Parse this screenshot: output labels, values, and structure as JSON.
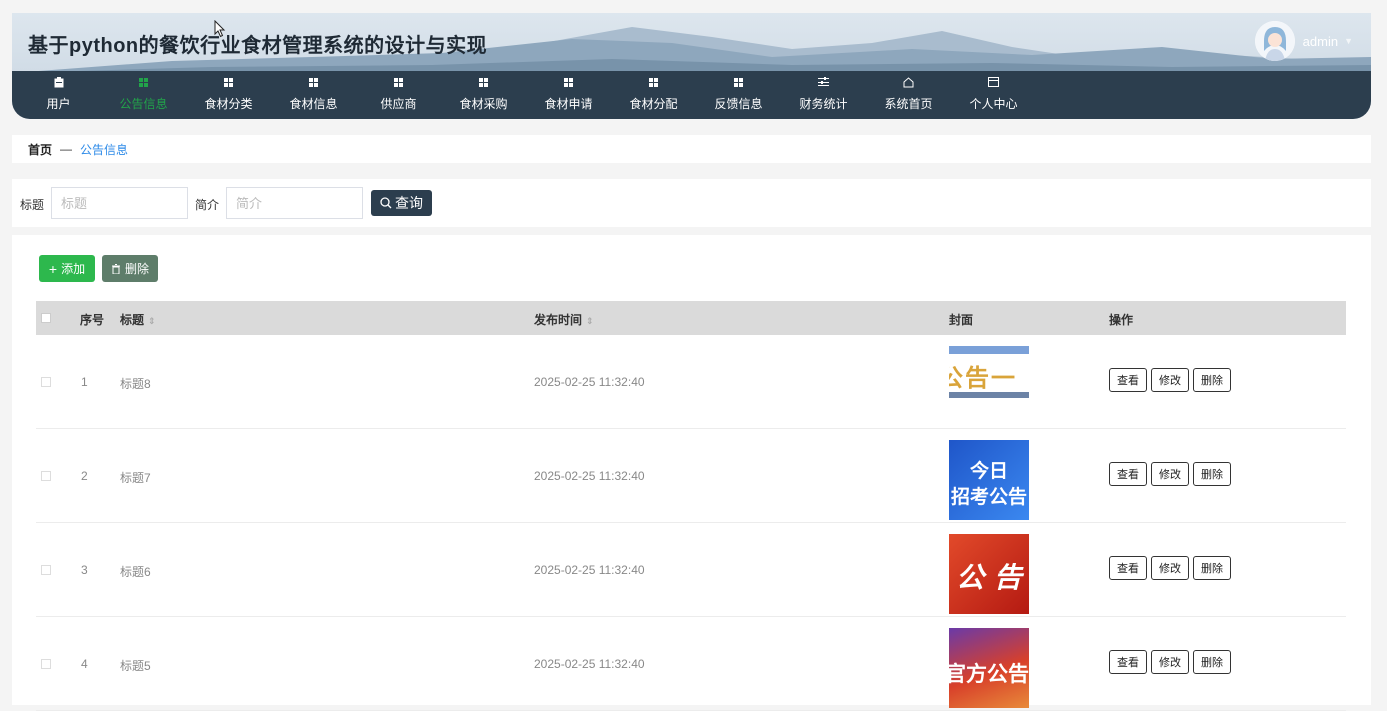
{
  "app": {
    "title": "基于python的餐饮行业食材管理系统的设计与实现"
  },
  "user": {
    "name": "admin"
  },
  "nav": [
    {
      "label": "用户",
      "icon": "clipboard-icon"
    },
    {
      "label": "公告信息",
      "icon": "grid-icon",
      "active": true
    },
    {
      "label": "食材分类",
      "icon": "grid-icon"
    },
    {
      "label": "食材信息",
      "icon": "grid-icon"
    },
    {
      "label": "供应商",
      "icon": "grid-icon"
    },
    {
      "label": "食材采购",
      "icon": "grid-icon"
    },
    {
      "label": "食材申请",
      "icon": "grid-icon"
    },
    {
      "label": "食材分配",
      "icon": "grid-icon"
    },
    {
      "label": "反馈信息",
      "icon": "grid-icon"
    },
    {
      "label": "财务统计",
      "icon": "sliders-icon"
    },
    {
      "label": "系统首页",
      "icon": "home-icon"
    },
    {
      "label": "个人中心",
      "icon": "calendar-icon"
    }
  ],
  "breadcrumb": {
    "home": "首页",
    "separator": "—",
    "current": "公告信息"
  },
  "search": {
    "title_label": "标题",
    "title_placeholder": "标题",
    "intro_label": "简介",
    "intro_placeholder": "简介",
    "query_label": "查询"
  },
  "toolbar": {
    "add_label": "添加",
    "delete_label": "删除"
  },
  "table": {
    "columns": {
      "index": "序号",
      "title": "标题",
      "time": "发布时间",
      "cover": "封面",
      "actions": "操作"
    },
    "rows": [
      {
        "index": "1",
        "title": "标题8",
        "time": "2025-02-25 11:32:40",
        "cover_text": "公告一"
      },
      {
        "index": "2",
        "title": "标题7",
        "time": "2025-02-25 11:32:40",
        "cover_text_1": "今日",
        "cover_text_2": "招考公告"
      },
      {
        "index": "3",
        "title": "标题6",
        "time": "2025-02-25 11:32:40",
        "cover_text": "公 告"
      },
      {
        "index": "4",
        "title": "标题5",
        "time": "2025-02-25 11:32:40",
        "cover_text": "官方公告"
      }
    ],
    "actions": {
      "view": "查看",
      "edit": "修改",
      "delete": "删除"
    }
  },
  "colors": {
    "navbar": "#2c3e4e",
    "accent": "#22a34a",
    "add_button": "#2db84d",
    "delete_button": "#5e7d6a",
    "link": "#2c8ae8"
  }
}
